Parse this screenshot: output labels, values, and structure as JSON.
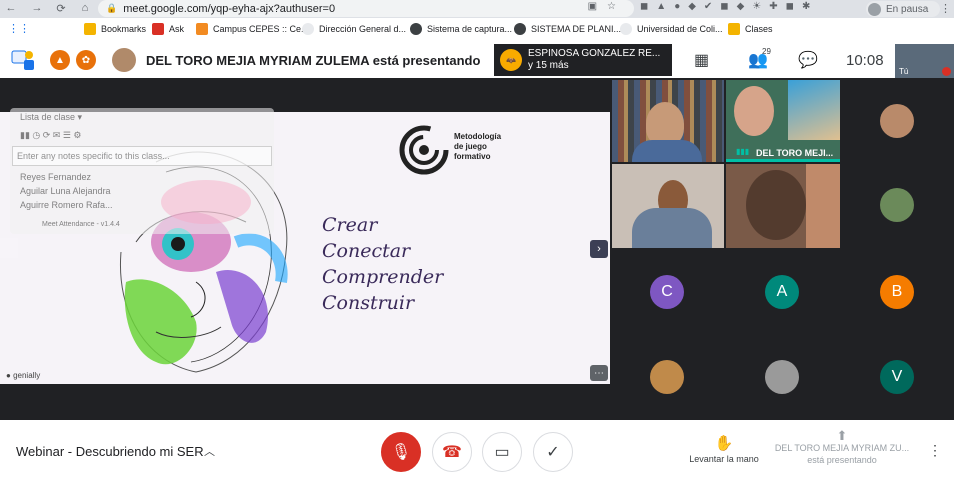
{
  "browser": {
    "url": "meet.google.com/yqp-eyha-ajx?authuser=0",
    "profile_label": "En pausa"
  },
  "bookmarks": [
    {
      "label": "Bookmarks",
      "color": "#f4b400"
    },
    {
      "label": "Ask",
      "color": "#d93025"
    },
    {
      "label": "Campus CEPES :: Ce...",
      "color": "#5f6368"
    },
    {
      "label": "Dirección General d...",
      "color": "#5f6368"
    },
    {
      "label": "Sistema de captura...",
      "color": "#5f6368"
    },
    {
      "label": "SISTEMA DE PLANI...",
      "color": "#5f6368"
    },
    {
      "label": "Universidad de Coli...",
      "color": "#5f6368"
    },
    {
      "label": "Clases",
      "color": "#f4b400"
    }
  ],
  "header": {
    "presenting_text": "DEL TORO MEJIA MYRIAM ZULEMA está presentando",
    "speaker_name": "ESPINOSA GONZALEZ RE...",
    "speaker_more": "y 15 más",
    "people_count": "29",
    "time": "10:08",
    "self_label": "Tú"
  },
  "slide": {
    "logo_lines": [
      "Metodología",
      "de juego",
      "formativo"
    ],
    "script_lines": [
      "Crear",
      "Conectar",
      "Comprender",
      "Construir"
    ],
    "brand": "genially"
  },
  "attendance": {
    "title": "Lista de clase",
    "notes_placeholder": "Enter any notes specific to this class...",
    "rows": [
      "Reyes Fernandez",
      "Aguilar Luna Alejandra",
      "Aguirre Romero Rafa..."
    ],
    "footer": "Meet Attendance - v1.4.4"
  },
  "participants": {
    "presenter_tile_name": "DEL TORO MEJI...",
    "initials": [
      {
        "letter": "C",
        "color": "#7e57c2"
      },
      {
        "letter": "A",
        "color": "#00897b"
      },
      {
        "letter": "B",
        "color": "#f57c00"
      },
      {
        "letter": "V",
        "color": "#00695c"
      }
    ]
  },
  "bottom_bar": {
    "meeting_title": "Webinar - Descubriendo mi SER",
    "raise_hand": "Levantar la mano",
    "presenting_name": "DEL TORO MEJIA MYRIAM ZU...",
    "presenting_suffix": "está presentando"
  }
}
